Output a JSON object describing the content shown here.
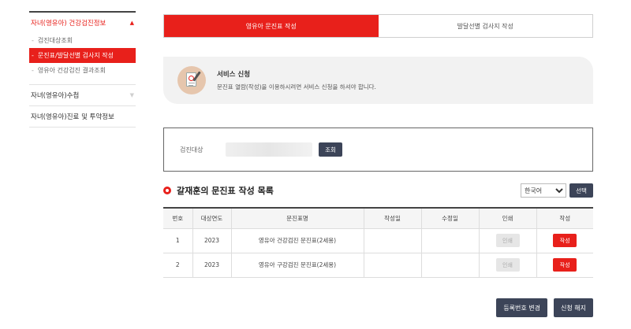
{
  "sidebar": {
    "groups": [
      {
        "label": "자녀(영유아) 건강검진정보",
        "indicator": "up-triangle-icon"
      },
      {
        "label": "자녀(영유아)수첩",
        "indicator": "down-triangle-icon"
      },
      {
        "label": "자녀(영유아)진료 및 투약정보"
      }
    ],
    "subitems": [
      {
        "label": "검진대상조회"
      },
      {
        "label": "문진표/발달선별 검사지 작성"
      },
      {
        "label": "영유아 건강검진 결과조회"
      }
    ],
    "triangles": {
      "up": "▲",
      "down": "▼"
    },
    "dash": "-"
  },
  "tabs": [
    {
      "label": "영유아 문진표 작성"
    },
    {
      "label": "발달선별 검사지 작성"
    }
  ],
  "service": {
    "title": "서비스 신청",
    "description": "문진표 열람(작성)을 이용하시려면 서비스 신청을 하셔야 합니다."
  },
  "search": {
    "label": "검진대상",
    "button": "조회"
  },
  "list": {
    "title": "갈재훈의 문진표 작성 목록",
    "language_options": [
      "한국어"
    ],
    "language_selected": "한국어",
    "select_button": "선택"
  },
  "table": {
    "columns": [
      "번호",
      "대상연도",
      "문진표명",
      "작성일",
      "수정일",
      "인쇄",
      "작성"
    ],
    "rows": [
      {
        "no": "1",
        "year": "2023",
        "name": "영유아 건강검진 문진표(2세용)",
        "written": "",
        "modified": "",
        "print": "인쇄",
        "write": "작성"
      },
      {
        "no": "2",
        "year": "2023",
        "name": "영유아 구강검진 문진표(2세용)",
        "written": "",
        "modified": "",
        "print": "인쇄",
        "write": "작성"
      }
    ]
  },
  "bottom": {
    "change_reg": "등록번호 변경",
    "cancel": "신청 해지"
  },
  "colors": {
    "accent": "#e8201b",
    "dark_button": "#3c4458"
  }
}
